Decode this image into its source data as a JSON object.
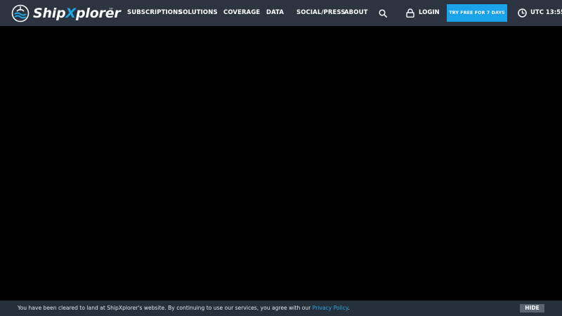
{
  "header": {
    "logo": {
      "text_before": "Ship",
      "text_accent": "X",
      "text_after": "plorer",
      "trademark": "™",
      "icon": "ship-wave-globe-icon"
    },
    "nav": [
      {
        "label": "SUBSCRIPTIONS"
      },
      {
        "label": "SOLUTIONS"
      },
      {
        "label": "COVERAGE"
      },
      {
        "label": "DATA"
      },
      {
        "label": "SOCIAL/PRESS"
      },
      {
        "label": "ABOUT"
      }
    ],
    "search_icon": "search-icon",
    "login": {
      "icon": "lock-icon",
      "label": "LOGIN"
    },
    "cta_label": "TRY FREE FOR 7 DAYS",
    "clock": {
      "icon": "clock-icon",
      "time": "UTC 13:55"
    }
  },
  "cookie_bar": {
    "text": "You have been cleared to land at ShipXplorer's website. By continuing to use our services, you agree with our ",
    "link_label": "Privacy Policy",
    "suffix": ".",
    "hide_label": "HIDE"
  },
  "colors": {
    "navbar_bg": "#2b3440",
    "accent": "#1aa3ea",
    "page_bg": "#000000",
    "cookie_bg": "#25303a"
  }
}
